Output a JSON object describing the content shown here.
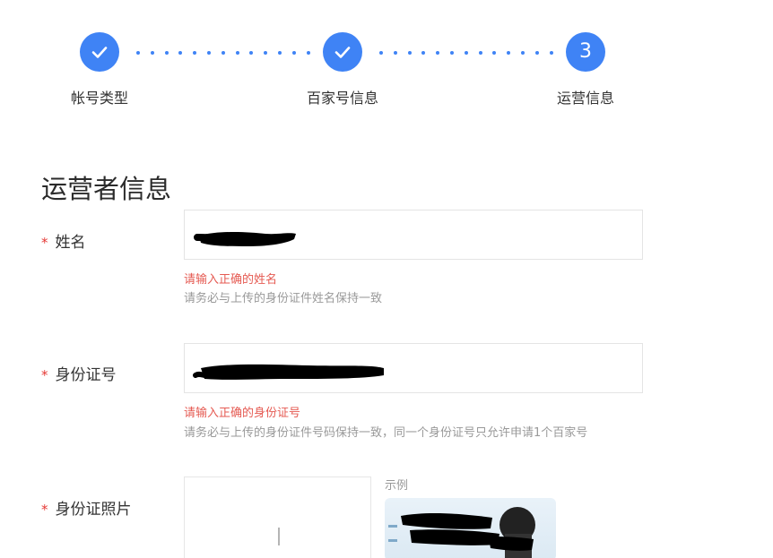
{
  "colors": {
    "accent": "#3f83f5",
    "required": "#e53935",
    "error": "#e55a52",
    "hint": "#999999"
  },
  "stepper": {
    "steps": [
      {
        "label": "帐号类型",
        "state": "done",
        "icon": "check-icon"
      },
      {
        "label": "百家号信息",
        "state": "done",
        "icon": "check-icon"
      },
      {
        "label": "运营信息",
        "state": "current",
        "number": "3"
      }
    ]
  },
  "section": {
    "title": "运营者信息"
  },
  "form": {
    "required_mark": "*",
    "name": {
      "label": "姓名",
      "value": "",
      "error": "请输入正确的姓名",
      "hint": "请务必与上传的身份证件姓名保持一致"
    },
    "id_number": {
      "label": "身份证号",
      "value": "",
      "error": "请输入正确的身份证号",
      "hint": "请务必与上传的身份证件号码保持一致，同一个身份证号只允许申请1个百家号"
    },
    "id_photo": {
      "label": "身份证照片",
      "example_label": "示例",
      "upload_icon": "plus-icon"
    }
  }
}
